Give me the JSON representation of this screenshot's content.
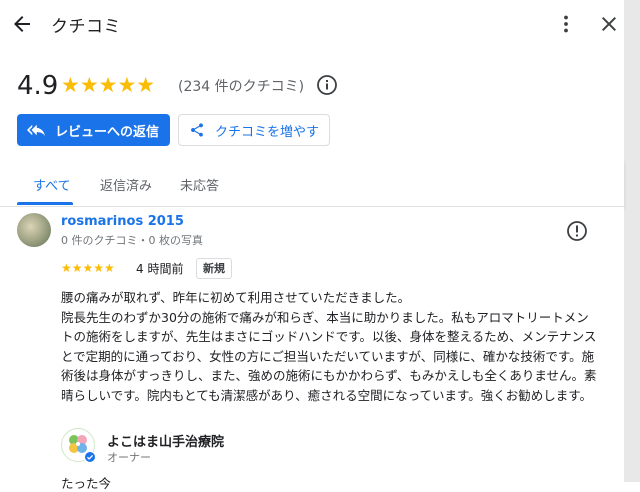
{
  "header": {
    "title": "クチコミ"
  },
  "summary": {
    "rating": "4.9",
    "stars": "★★★★★",
    "review_count": "(234 件のクチコミ)"
  },
  "actions": {
    "reply_label": "レビューへの返信",
    "share_label": "クチコミを増やす"
  },
  "tabs": [
    {
      "label": "すべて",
      "active": true
    },
    {
      "label": "返信済み",
      "active": false
    },
    {
      "label": "未応答",
      "active": false
    }
  ],
  "review": {
    "author": "rosmarinos 2015",
    "meta": "0 件のクチコミ・0 枚の写真",
    "stars": "★★★★★",
    "time": "4 時間前",
    "badge": "新規",
    "text": "腰の痛みが取れず、昨年に初めて利用させていただきました。\n院長先生のわずか30分の施術で痛みが和らぎ、本当に助かりました。私もアロマトリートメントの施術をしますが、先生はまさにゴッドハンドです。以後、身体を整えるため、メンテナンスとで定期的に通っており、女性の方にご担当いただいていますが、同様に、確かな技術です。施術後は身体がすっきりし、また、強めの施術にもかかわらず、もみかえしも全くありません。素晴らしいです。院内もとても清潔感があり、癒される空間になっています。強くお勧めします。"
  },
  "owner": {
    "name": "よこはま山手治療院",
    "role": "オーナー",
    "reply_preview": "たった今"
  },
  "colors": {
    "accent": "#1a73e8",
    "star": "#fbbc04",
    "text": "#202124",
    "muted": "#5f6368"
  },
  "icons": [
    "back-arrow-icon",
    "more-vert-icon",
    "close-icon",
    "info-icon",
    "reply-icon",
    "share-icon",
    "flag-icon",
    "verified-icon",
    "clover-logo-icon"
  ]
}
